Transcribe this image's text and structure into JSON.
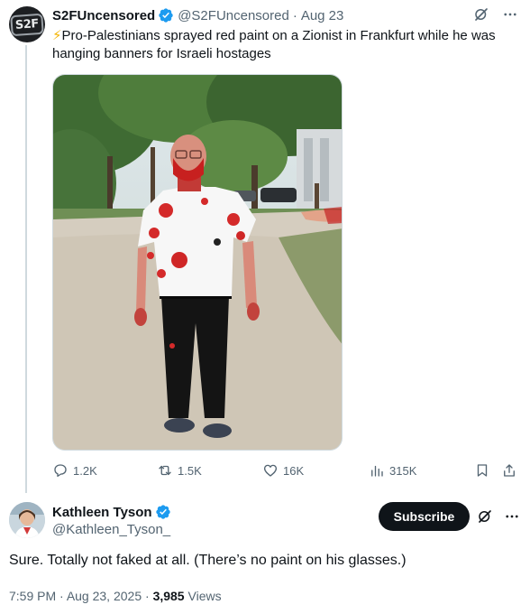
{
  "tweet": {
    "author_name": "S2FUncensored",
    "author_handle": "@S2FUncensored",
    "date": "Aug 23",
    "avatar_text": "S2F",
    "emoji": "⚡",
    "text": "Pro-Palestinians sprayed red paint on a Zionist in Frankfurt while he was hanging banners for Israeli hostages",
    "stats": {
      "replies": "1.2K",
      "reposts": "1.5K",
      "likes": "16K",
      "views": "315K"
    }
  },
  "reply": {
    "author_name": "Kathleen Tyson",
    "author_handle": "@Kathleen_Tyson_",
    "subscribe_label": "Subscribe",
    "text": "Sure. Totally not faked at all. (There’s no paint on his glasses.)",
    "time": "7:59 PM",
    "date": "Aug 23, 2025",
    "views_count": "3,985",
    "views_label": "Views"
  },
  "colors": {
    "verified_blue": "#1d9bf0",
    "secondary_text": "#536471",
    "border": "#cfd9de"
  },
  "icons": [
    "verified-badge-icon",
    "grok-icon",
    "more-icon",
    "reply-icon",
    "repost-icon",
    "like-icon",
    "views-icon",
    "bookmark-icon",
    "share-icon"
  ]
}
